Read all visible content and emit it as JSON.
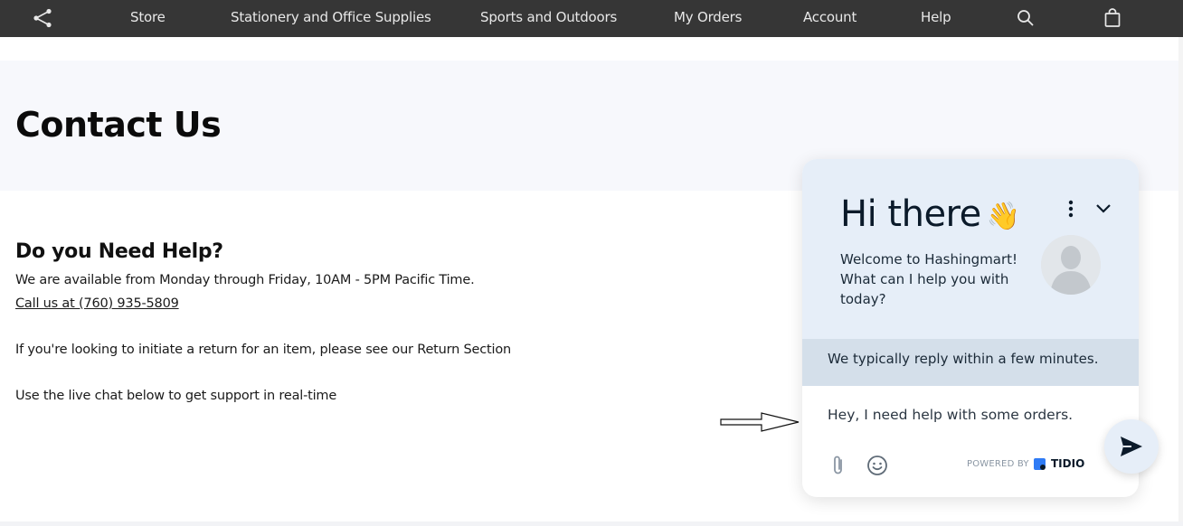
{
  "nav": {
    "share_icon": "share-icon",
    "items": [
      {
        "label": "Store"
      },
      {
        "label": "Stationery and Office Supplies"
      },
      {
        "label": "Sports and Outdoors"
      },
      {
        "label": "My Orders"
      },
      {
        "label": "Account"
      },
      {
        "label": "Help"
      }
    ],
    "search_icon": "search-icon",
    "cart_icon": "shopping-bag-icon"
  },
  "page": {
    "title": "Contact Us",
    "help_heading": "Do you Need Help?",
    "availability": "We are available from Monday through Friday, 10AM - 5PM Pacific Time.",
    "call_link": "Call us at (760) 935-5809",
    "return_text": "If you're looking to initiate a return for an item, please see our Return Section",
    "chat_text": "Use the live chat below to get support in real-time"
  },
  "chat": {
    "greeting": "Hi there",
    "wave_emoji": "👋",
    "welcome": "Welcome to Hashingmart! What can I help you with today?",
    "reply_notice": "We typically reply within a few minutes.",
    "message_value": "Hey, I need help with some orders.",
    "powered_by": "POWERED BY",
    "brand": "TIDIO"
  },
  "colors": {
    "nav_bg": "#363636",
    "hero_bg": "#f7f8fc",
    "chat_header_bg": "#e6eef8",
    "reply_bar_bg": "#d4dfea"
  }
}
